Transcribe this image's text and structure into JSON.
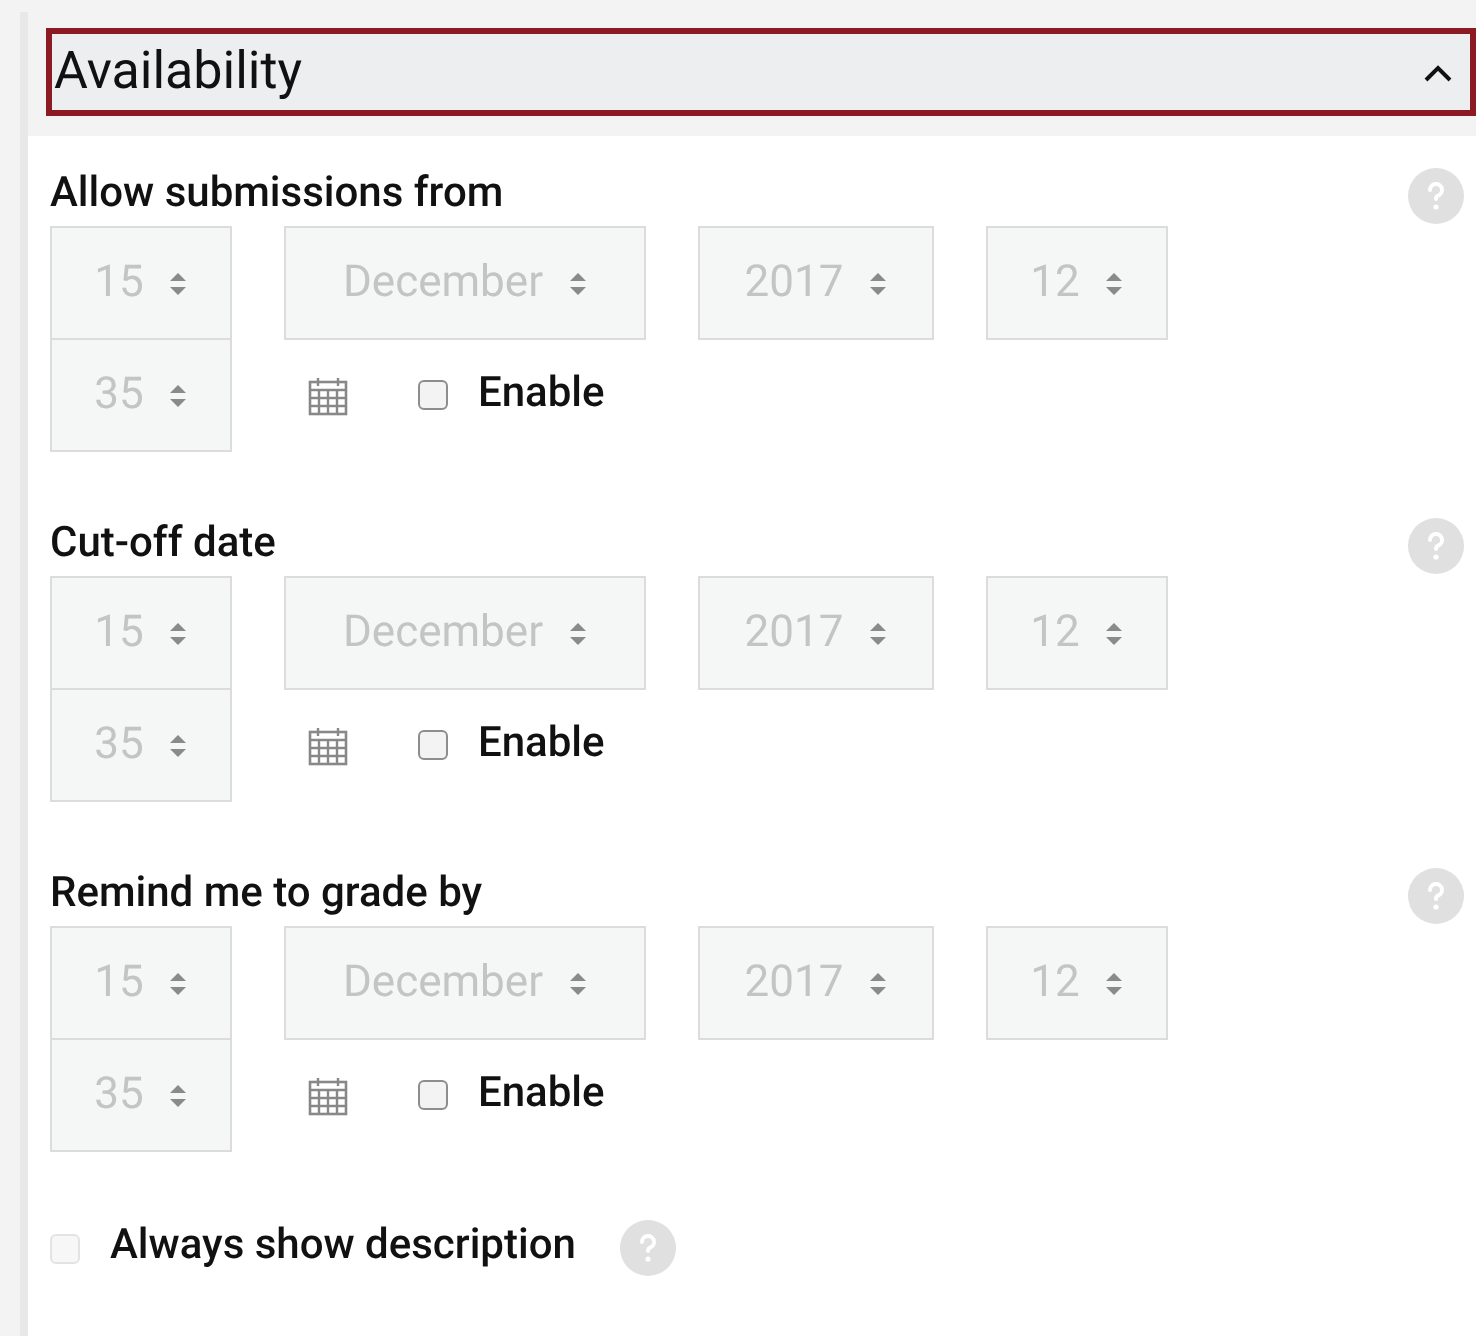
{
  "header": {
    "title": "Availability",
    "expanded": true
  },
  "date_fields": [
    {
      "label": "Allow submissions from",
      "day": "15",
      "month": "December",
      "year": "2017",
      "hour": "12",
      "minute": "35",
      "disabled": true,
      "enable": {
        "label": "Enable",
        "checked": false
      }
    },
    {
      "label": "Cut-off date",
      "day": "15",
      "month": "December",
      "year": "2017",
      "hour": "12",
      "minute": "35",
      "disabled": true,
      "enable": {
        "label": "Enable",
        "checked": false
      }
    },
    {
      "label": "Remind me to grade by",
      "day": "15",
      "month": "December",
      "year": "2017",
      "hour": "12",
      "minute": "35",
      "disabled": true,
      "enable": {
        "label": "Enable",
        "checked": false
      }
    }
  ],
  "always_show_description": {
    "label": "Always show description",
    "checked": false,
    "disabled": true
  }
}
